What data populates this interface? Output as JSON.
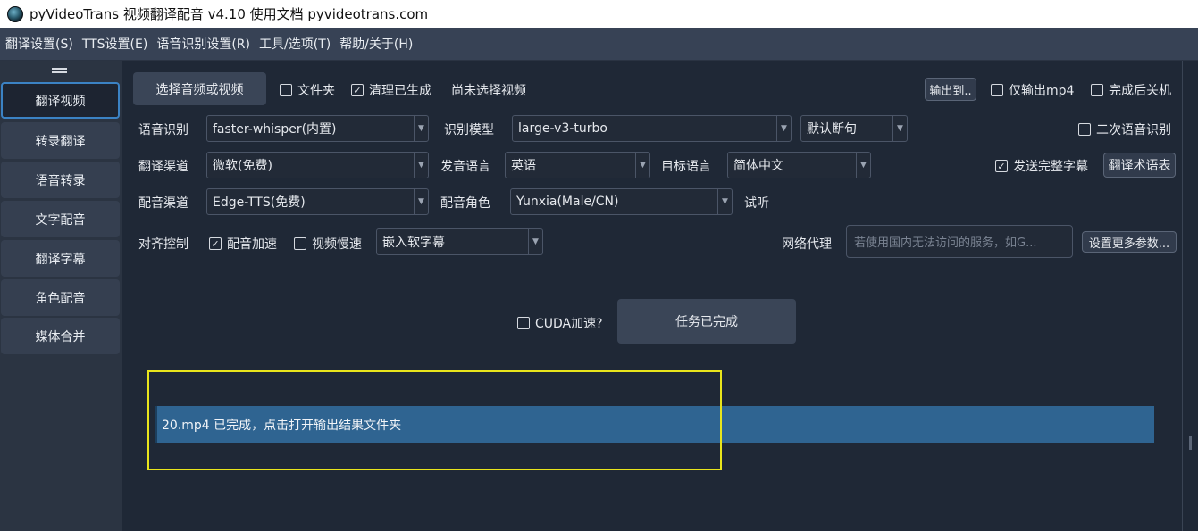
{
  "window": {
    "title": "pyVideoTrans 视频翻译配音 v4.10 使用文档 pyvideotrans.com"
  },
  "menu": [
    "翻译设置(S)",
    "TTS设置(E)",
    "语音识别设置(R)",
    "工具/选项(T)",
    "帮助/关于(H)"
  ],
  "sidebar": {
    "items": [
      {
        "label": "翻译视频",
        "active": true
      },
      {
        "label": "转录翻译"
      },
      {
        "label": "语音转录"
      },
      {
        "label": "文字配音"
      },
      {
        "label": "翻译字幕"
      },
      {
        "label": "角色配音"
      },
      {
        "label": "媒体合并"
      }
    ]
  },
  "top": {
    "select_media": "选择音频或视频",
    "folder": {
      "label": "文件夹",
      "checked": false
    },
    "clear_generated": {
      "label": "清理已生成",
      "checked": true
    },
    "status": "尚未选择视频",
    "output_to": "输出到..",
    "only_mp4": {
      "label": "仅输出mp4",
      "checked": false
    },
    "shutdown": {
      "label": "完成后关机",
      "checked": false
    }
  },
  "row_asr": {
    "label": "语音识别",
    "engine": "faster-whisper(内置)",
    "model_label": "识别模型",
    "model": "large-v3-turbo",
    "split": "默认断句",
    "second_asr": {
      "label": "二次语音识别",
      "checked": false
    }
  },
  "row_translate": {
    "label": "翻译渠道",
    "channel": "微软(免费)",
    "src_label": "发音语言",
    "src": "英语",
    "tgt_label": "目标语言",
    "tgt": "简体中文",
    "send_full": {
      "label": "发送完整字幕",
      "checked": true
    },
    "glossary": "翻译术语表"
  },
  "row_dub": {
    "label": "配音渠道",
    "channel": "Edge-TTS(免费)",
    "role_label": "配音角色",
    "role": "Yunxia(Male/CN)",
    "listen": "试听"
  },
  "row_align": {
    "label": "对齐控制",
    "dub_speed": {
      "label": "配音加速",
      "checked": true
    },
    "video_slow": {
      "label": "视频慢速",
      "checked": false
    },
    "subtitle": "嵌入软字幕",
    "proxy_label": "网络代理",
    "proxy_placeholder": "若使用国内无法访问的服务，如G...",
    "more_params": "设置更多参数..."
  },
  "run": {
    "cuda": {
      "label": "CUDA加速?",
      "checked": false
    },
    "button": "任务已完成"
  },
  "progress": {
    "text": "20.mp4  已完成，点击打开输出结果文件夹"
  },
  "colors": {
    "accent": "#3b82c4",
    "progress": "#2f6491",
    "highlight": "#e9e51c"
  }
}
